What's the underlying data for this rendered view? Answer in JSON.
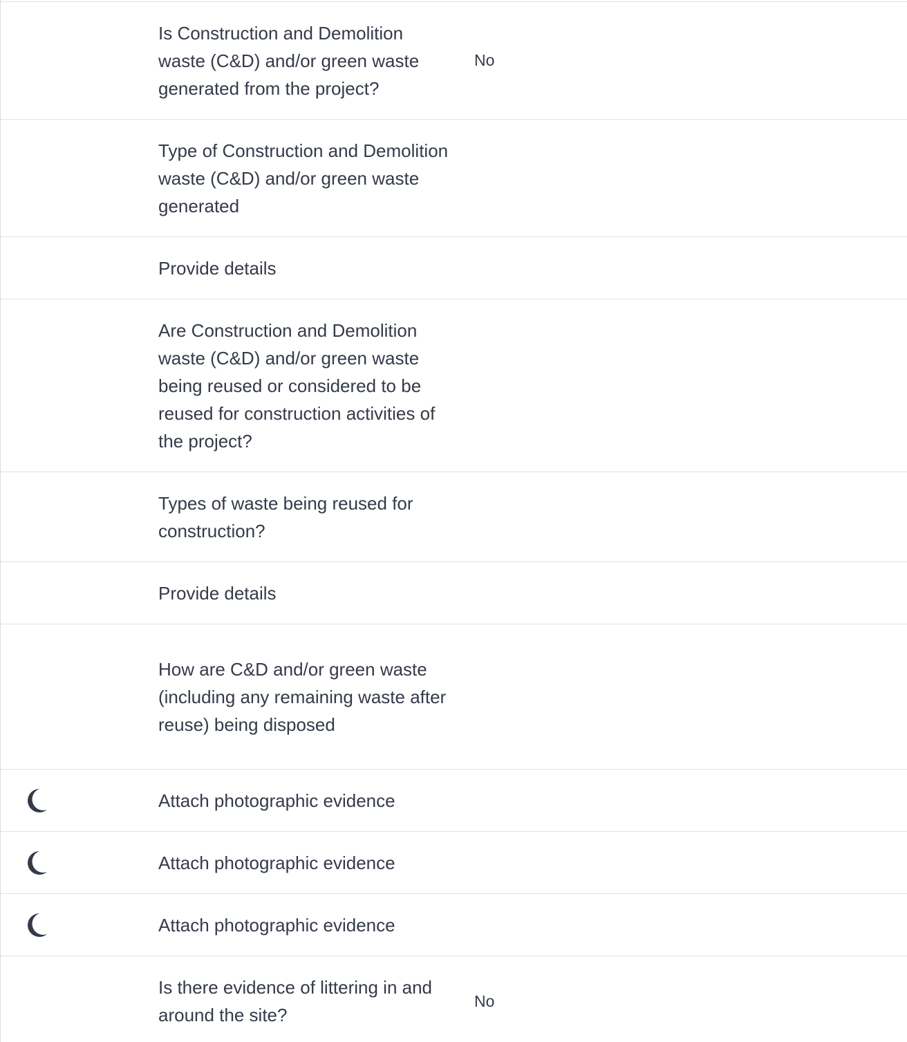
{
  "rows": [
    {
      "question": "Is Construction and Demolition waste (C&D) and/or green waste generated from the project?",
      "answer": "No"
    },
    {
      "question": "Type of Construction and Demolition waste (C&D) and/or green waste generated",
      "answer": ""
    },
    {
      "question": "Provide details",
      "answer": ""
    },
    {
      "question": "Are Construction and Demolition waste (C&D) and/or green waste being reused or considered to be reused for construction activities of the project?",
      "answer": ""
    },
    {
      "question": "Types of waste being reused for construction?",
      "answer": ""
    },
    {
      "question": "Provide details",
      "answer": ""
    },
    {
      "question": "How are C&D and/or green waste (including any remaining waste after reuse) being disposed",
      "answer": ""
    },
    {
      "question": "Attach photographic evidence",
      "answer": "",
      "icon": "moon-icon"
    },
    {
      "question": "Attach photographic evidence",
      "answer": "",
      "icon": "moon-icon"
    },
    {
      "question": "Attach photographic evidence",
      "answer": "",
      "icon": "moon-icon"
    },
    {
      "question": "Is there evidence of littering in and around the site?",
      "answer": "No"
    }
  ],
  "colors": {
    "text": "#343a4a",
    "divider": "#e0e0e0",
    "icon": "#343a4a"
  }
}
